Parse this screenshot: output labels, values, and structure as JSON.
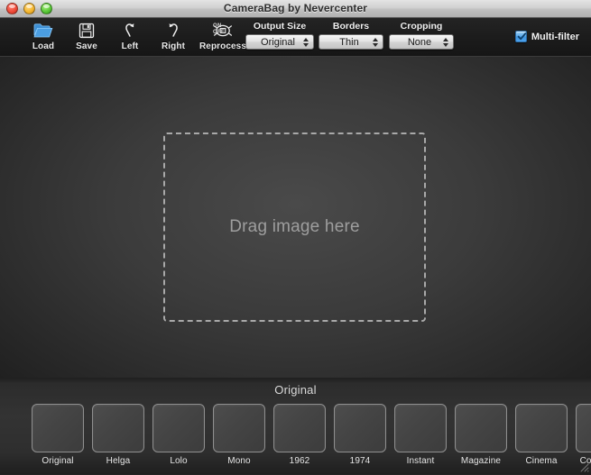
{
  "window": {
    "title": "CameraBag by Nevercenter",
    "controls": {
      "close": "close-button",
      "minimize": "minimize-button",
      "zoom": "zoom-button"
    }
  },
  "toolbar": {
    "buttons": [
      {
        "label": "Load",
        "icon": "open-folder-icon"
      },
      {
        "label": "Save",
        "icon": "floppy-disk-icon"
      },
      {
        "label": "Left",
        "icon": "rotate-left-icon"
      },
      {
        "label": "Right",
        "icon": "rotate-right-icon"
      },
      {
        "label": "Reprocess",
        "icon": "reprocess-icon"
      }
    ],
    "reprocess_toggle": {
      "on": "ON",
      "off": "OFF"
    },
    "popups": [
      {
        "caption": "Output Size",
        "value": "Original"
      },
      {
        "caption": "Borders",
        "value": "Thin"
      },
      {
        "caption": "Cropping",
        "value": "None"
      }
    ],
    "multifilter": {
      "label": "Multi-filter",
      "checked": true
    }
  },
  "canvas": {
    "dropzone_text": "Drag image here"
  },
  "filter_strip": {
    "current_filter": "Original",
    "thumbnails": [
      {
        "label": "Original"
      },
      {
        "label": "Helga"
      },
      {
        "label": "Lolo"
      },
      {
        "label": "Mono"
      },
      {
        "label": "1962"
      },
      {
        "label": "1974"
      },
      {
        "label": "Instant"
      },
      {
        "label": "Magazine"
      },
      {
        "label": "Cinema"
      },
      {
        "label": "Colorcross"
      }
    ]
  },
  "colors": {
    "accent_blue": "#4ea4ef",
    "folder_icon": "#3d8fd4",
    "toolbar_bg": "#1c1c1c",
    "canvas_center": "#4a4a4a",
    "strip_bg": "#333333"
  }
}
